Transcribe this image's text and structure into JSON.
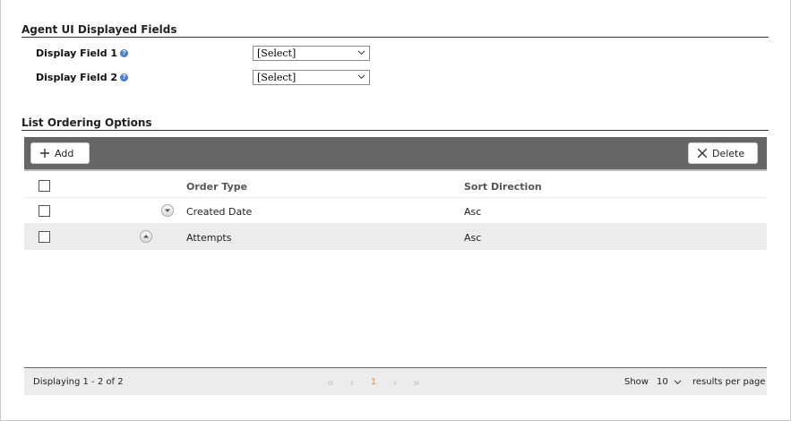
{
  "sections": {
    "agent_fields_title": "Agent UI Displayed Fields",
    "list_ordering_title": "List Ordering Options"
  },
  "fields": [
    {
      "label": "Display Field 1",
      "value": "[Select]"
    },
    {
      "label": "Display Field 2",
      "value": "[Select]"
    }
  ],
  "toolbar": {
    "add_label": "Add",
    "delete_label": "Delete"
  },
  "grid": {
    "headers": {
      "order_type": "Order Type",
      "sort_direction": "Sort Direction"
    },
    "rows": [
      {
        "order_type": "Created Date",
        "sort_direction": "Asc",
        "move": "down"
      },
      {
        "order_type": "Attempts",
        "sort_direction": "Asc",
        "move": "up"
      }
    ]
  },
  "footer": {
    "displaying": "Displaying 1 - 2 of 2",
    "current_page": "1",
    "show_label": "Show",
    "per_page": "10",
    "per_page_suffix": "results per page"
  },
  "colors": {
    "toolbar": "#666666",
    "alt_row": "#ececec",
    "accent_page": "#e8883a",
    "help_icon": "#4a7fd1"
  }
}
